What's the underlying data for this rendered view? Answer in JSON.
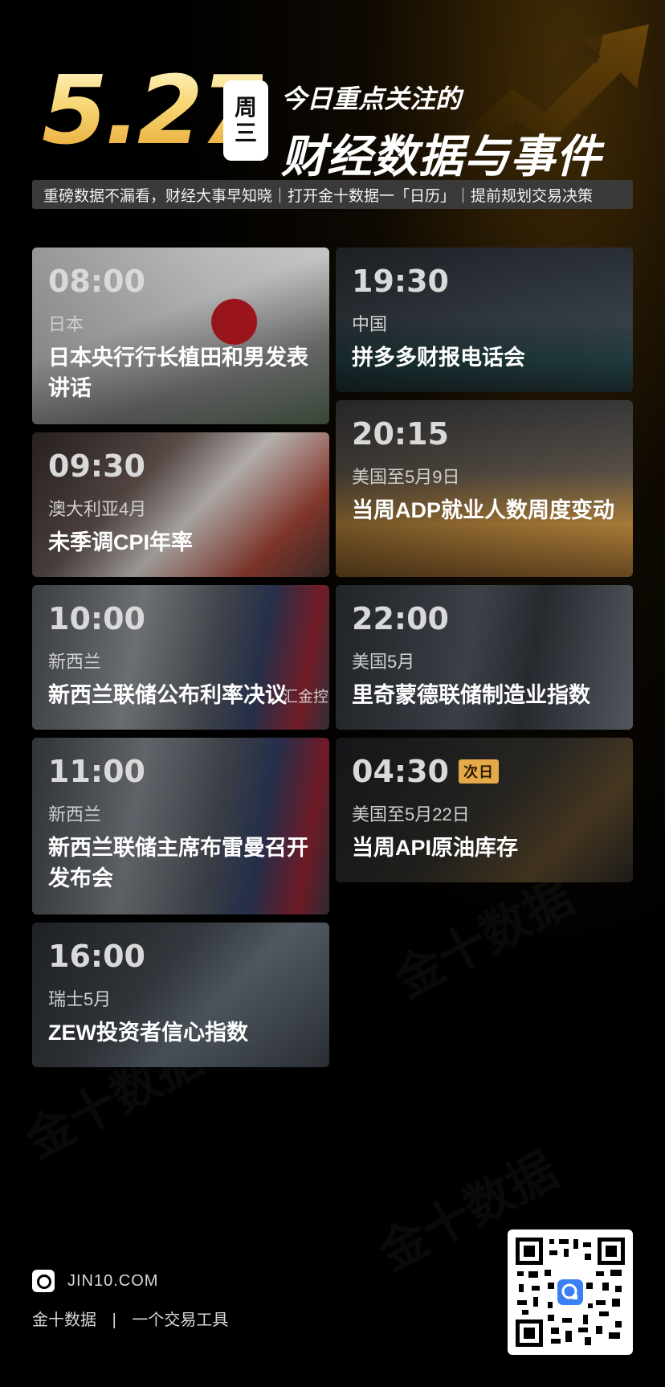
{
  "header": {
    "date": "5.27",
    "weekday_top": "周",
    "weekday_bottom": "三",
    "headline_line1": "今日重点关注的",
    "headline_line2": "财经数据与事件",
    "tagline": "重磅数据不漏看，财经大事早知晓｜打开金十数据一「日历」｜提前规划交易决策"
  },
  "events": [
    {
      "time": "08:00",
      "region": "日本",
      "title": "日本央行行长植田和男发表讲话",
      "bg": "japan"
    },
    {
      "time": "19:30",
      "region": "中国",
      "title": "拼多多财报电话会",
      "bg": "city"
    },
    {
      "time": "09:30",
      "region": "澳大利亚4月",
      "title": "未季调CPI年率",
      "bg": "cpi"
    },
    {
      "time": "20:15",
      "region": "美国至5月9日",
      "title": "当周ADP就业人数周度变动",
      "bg": "office"
    },
    {
      "time": "10:00",
      "region": "新西兰",
      "title": "新西兰联储公布利率决议",
      "bg": "nz"
    },
    {
      "time": "22:00",
      "region": "美国5月",
      "title": "里奇蒙德联储制造业指数",
      "bg": "tower"
    },
    {
      "time": "11:00",
      "region": "新西兰",
      "title": "新西兰联储主席布雷曼召开发布会",
      "bg": "nz"
    },
    {
      "time": "04:30",
      "badge": "次日",
      "region": "美国至5月22日",
      "title": "当周API原油库存",
      "bg": "api"
    },
    {
      "time": "16:00",
      "region": "瑞士5月",
      "title": "ZEW投资者信心指数",
      "bg": "zew"
    }
  ],
  "watermark_text": "汇金控",
  "footer": {
    "url": "JIN10.COM",
    "brand": "金十数据",
    "separator": "|",
    "slogan": "一个交易工具"
  }
}
